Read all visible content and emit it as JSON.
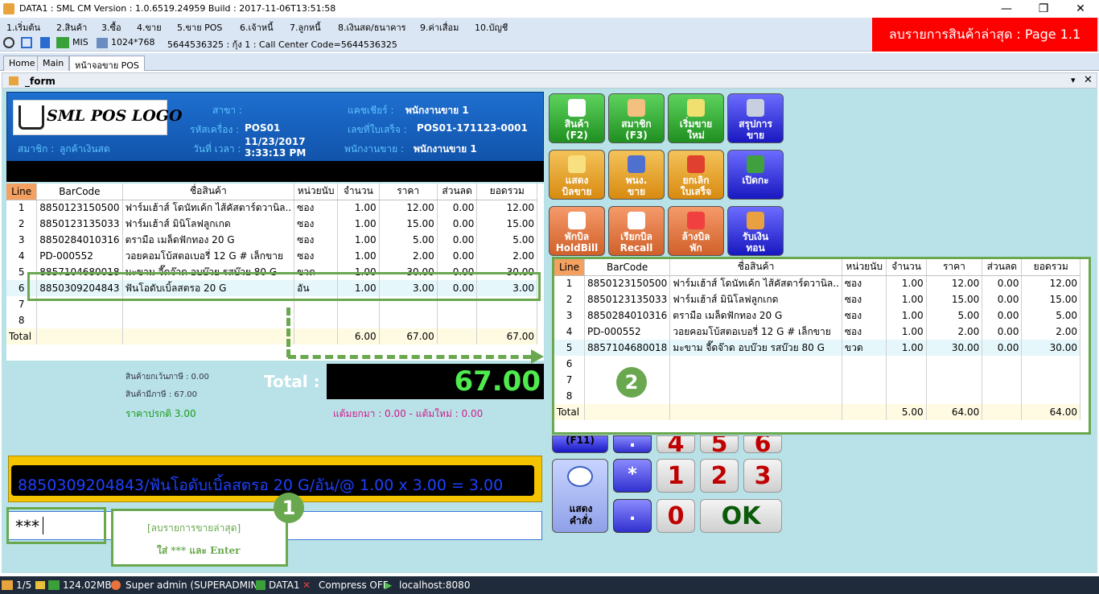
{
  "window": {
    "title": "DATA1 : SML CM Version : 1.0.6519.24959  Build : 2017-11-06T13:51:58",
    "minimize": "—",
    "restore": "❐",
    "close": "✕"
  },
  "menu": [
    "1.เริ่มต้น",
    "2.สินค้า",
    "3.ซื้อ",
    "4.ขาย",
    "5.ขาย POS",
    "6.เจ้าหนี้",
    "7.ลูกหนี้",
    "8.เงินสด/ธนาคาร",
    "9.ค่าเสื่อม",
    "10.บัญชี"
  ],
  "toolbar": {
    "mis": "MIS",
    "resolution": "1024*768",
    "info": "5644536325 : กุ้ง 1 : Call Center Code=5644536325"
  },
  "banner": "ลบรายการสินค้าล่าสุด : Page 1.1",
  "tabs": [
    "Home",
    "Main",
    "หน้าจอขาย POS"
  ],
  "form_title": "_form",
  "header": {
    "logo": "SML POS LOGO",
    "branch_label": "สาขา :",
    "machine_label": "รหัสเครื่อง :",
    "machine": "POS01",
    "datetime_label": "วันที่ เวลา :",
    "date": "11/23/2017",
    "time": "3:33:13 PM",
    "member_label": "สมาชิก :",
    "member": "ลูกค้าเงินสด",
    "cashier_label": "แคชเชียร์ :",
    "cashier": "พนักงานขาย 1",
    "receipt_label": "เลขที่ใบเสร็จ :",
    "receipt": "POS01-171123-0001",
    "sales_label": "พนักงานขาย :",
    "sales": "พนักงานขาย 1"
  },
  "grid_headers": [
    "Line",
    "BarCode",
    "ชื่อสินค้า",
    "หน่วยนับ",
    "จำนวน",
    "ราคา",
    "ส่วนลด",
    "ยอดรวม"
  ],
  "grid1": {
    "rows": [
      [
        "1",
        "8850123150500",
        "ฟาร์มเฮ้าส์  โดนัทเค้ก ไส้คัสตาร์ดวานิล..",
        "ซอง",
        "1.00",
        "12.00",
        "0.00",
        "12.00"
      ],
      [
        "2",
        "8850123135033",
        "ฟาร์มเฮ้าส์  มินิโลฟลูกเกด",
        "ซอง",
        "1.00",
        "15.00",
        "0.00",
        "15.00"
      ],
      [
        "3",
        "8850284010316",
        "ตรามือ เมล็ดฟักทอง 20 G",
        "ซอง",
        "1.00",
        "5.00",
        "0.00",
        "5.00"
      ],
      [
        "4",
        "PD-000552",
        "วอยคอมโบ้สตอเบอรี่  12 G # เล็กขาย",
        "ซอง",
        "1.00",
        "2.00",
        "0.00",
        "2.00"
      ],
      [
        "5",
        "8857104680018",
        "มะขาม จี๊ดจ๊าด อบบ๊วย รสบ๊วย 80 G",
        "ขวด",
        "1.00",
        "30.00",
        "0.00",
        "30.00"
      ],
      [
        "6",
        "8850309204843",
        "ฟันโอดับเบิ้ลสตรอ  20 G",
        "อัน",
        "1.00",
        "3.00",
        "0.00",
        "3.00"
      ],
      [
        "7",
        "",
        "",
        "",
        "",
        "",
        "",
        ""
      ],
      [
        "8",
        "",
        "",
        "",
        "",
        "",
        "",
        ""
      ]
    ],
    "total": [
      "Total",
      "",
      "",
      "",
      "6.00",
      "67.00",
      "",
      "67.00"
    ]
  },
  "grid2": {
    "rows": [
      [
        "1",
        "8850123150500",
        "ฟาร์มเฮ้าส์  โดนัทเค้ก ไส้คัสตาร์ดวานิล..",
        "ซอง",
        "1.00",
        "12.00",
        "0.00",
        "12.00"
      ],
      [
        "2",
        "8850123135033",
        "ฟาร์มเฮ้าส์  มินิโลฟลูกเกด",
        "ซอง",
        "1.00",
        "15.00",
        "0.00",
        "15.00"
      ],
      [
        "3",
        "8850284010316",
        "ตรามือ เมล็ดฟักทอง 20 G",
        "ซอง",
        "1.00",
        "5.00",
        "0.00",
        "5.00"
      ],
      [
        "4",
        "PD-000552",
        "วอยคอมโบ้สตอเบอรี่  12 G # เล็กขาย",
        "ซอง",
        "1.00",
        "2.00",
        "0.00",
        "2.00"
      ],
      [
        "5",
        "8857104680018",
        "มะขาม จี๊ดจ๊าด อบบ๊วย รสบ๊วย 80 G",
        "ขวด",
        "1.00",
        "30.00",
        "0.00",
        "30.00"
      ],
      [
        "6",
        "",
        "",
        "",
        "",
        "",
        "",
        ""
      ],
      [
        "7",
        "",
        "",
        "",
        "",
        "",
        "",
        ""
      ],
      [
        "8",
        "",
        "",
        "",
        "",
        "",
        "",
        ""
      ]
    ],
    "total": [
      "Total",
      "",
      "",
      "",
      "5.00",
      "64.00",
      "",
      "64.00"
    ]
  },
  "summary": {
    "nonvat": "สินค้ายกเว้นภาษี : 0.00",
    "vat": "สินค้ามีภาษี : 67.00",
    "normal_price": "ราคาปรกติ 3.00",
    "points": "แต้มยกมา : 0.00 - แต้มใหม่ : 0.00",
    "total_label": "Total :",
    "total_value": "67.00"
  },
  "buttons": [
    {
      "l1": "สินค้า",
      "l2": "(F2)"
    },
    {
      "l1": "สมาชิก",
      "l2": "(F3)"
    },
    {
      "l1": "เริ่มขาย",
      "l2": "ใหม่"
    },
    {
      "l1": "สรุปการ",
      "l2": "ขาย"
    },
    {
      "l1": "แสดง",
      "l2": "บิลขาย"
    },
    {
      "l1": "พนง.",
      "l2": "ขาย"
    },
    {
      "l1": "ยกเลิก",
      "l2": "ใบเสร็จ"
    },
    {
      "l1": "เปิดกะ",
      "l2": ""
    },
    {
      "l1": "พักบิล",
      "l2": "HoldBill"
    },
    {
      "l1": "เรียกบิล",
      "l2": "Recall"
    },
    {
      "l1": "ล้างบิล",
      "l2": "พัก"
    },
    {
      "l1": "รับเงิน",
      "l2": "ทอน"
    }
  ],
  "keypad": {
    "f11": "(F11)",
    "show_cmd_1": "แสดง",
    "show_cmd_2": "คำสั่ง",
    "star": "*",
    "dot": ".",
    "k1": "1",
    "k2": "2",
    "k3": "3",
    "k0": "0",
    "ok": "OK",
    "k4": "4",
    "k5": "5",
    "k6": "6",
    "kdot_top": "."
  },
  "input_display": "8850309204843/ฟันโอดับเบิ้ลสตรอ  20 G/อัน/@ 1.00 x 3.00 = 3.00",
  "entry_value": "***",
  "callout": {
    "line1": "[ลบรายการขายล่าสุด]",
    "line2": "ใส่ *** และ Enter",
    "step1": "1",
    "step2": "2"
  },
  "status": {
    "page": "1/5",
    "memory": "124.02MB",
    "user": "Super admin (SUPERADMIN)",
    "db": "DATA1",
    "compress": "Compress OFF",
    "server": "localhost:8080"
  },
  "colors": {
    "green_frame": "#6aa84f",
    "banner": "#ff0000",
    "total_value": "#4eea4e"
  }
}
